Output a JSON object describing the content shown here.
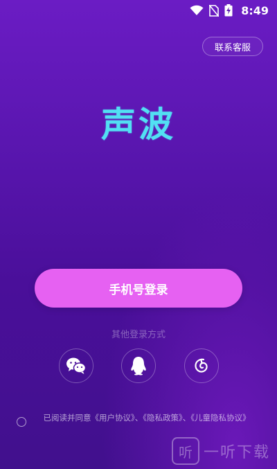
{
  "status_bar": {
    "time": "8:49",
    "icons": [
      "wifi-icon",
      "no-sim-icon",
      "battery-charging-icon"
    ]
  },
  "header": {
    "support_label": "联系客服"
  },
  "logo": {
    "text": "声波"
  },
  "main": {
    "phone_login_label": "手机号登录",
    "other_login_label": "其他登录方式",
    "social": [
      {
        "name": "wechat",
        "icon": "wechat-icon"
      },
      {
        "name": "qq",
        "icon": "qq-penguin-icon"
      },
      {
        "name": "netease",
        "icon": "netease-music-icon"
      }
    ]
  },
  "agreement": {
    "text": "已阅读并同意《用户协议》、《隐私政策》、《儿童隐私协议》"
  },
  "watermark": {
    "box_char": "听",
    "text": "一听下载"
  },
  "colors": {
    "accent": "#e661f2",
    "logo": "#52e0f3",
    "background_top": "#6b1cc4",
    "background_bottom": "#41108d"
  }
}
